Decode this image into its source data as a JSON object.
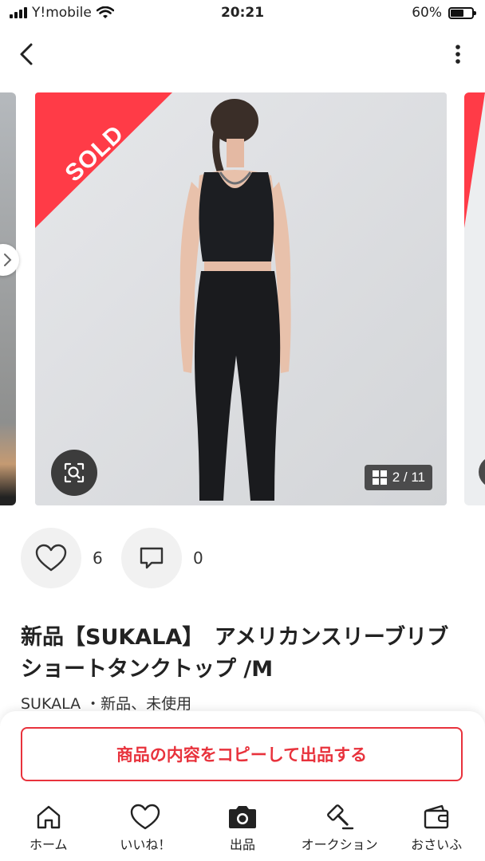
{
  "status_bar": {
    "carrier": "Y!mobile",
    "time": "20:21",
    "battery_percent": "60%",
    "battery_level": 0.6
  },
  "nav": {
    "back_icon": "chevron-left-icon",
    "more_icon": "vertical-ellipsis-icon"
  },
  "gallery": {
    "sold_label": "SOLD",
    "counter": "2 / 11",
    "accent_color": "#ff3b47"
  },
  "actions": {
    "like_count": "6",
    "comment_count": "0"
  },
  "product": {
    "title": "新品【SUKALA】　アメリカンスリーブリブショートタンクトップ /M",
    "meta": "SUKALA ・新品、未使用"
  },
  "copy_button": {
    "label": "商品の内容をコピーして出品する",
    "color": "#e8323c"
  },
  "tabbar": {
    "items": [
      {
        "label": "ホーム",
        "icon": "home-icon"
      },
      {
        "label": "いいね！",
        "icon": "heart-icon"
      },
      {
        "label": "出品",
        "icon": "camera-icon"
      },
      {
        "label": "オークション",
        "icon": "auction-hammer-icon"
      },
      {
        "label": "おさいふ",
        "icon": "wallet-icon"
      }
    ]
  }
}
